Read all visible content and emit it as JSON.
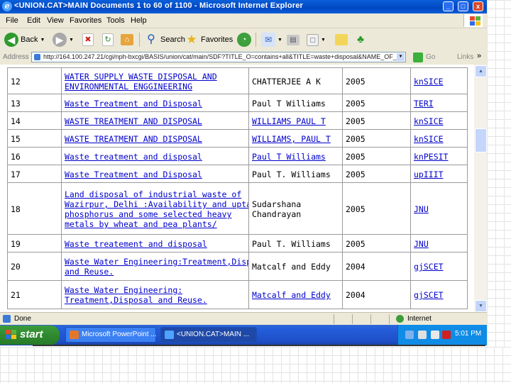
{
  "window": {
    "title": "<UNION.CAT>MAIN Documents 1 to 60 of 1100 - Microsoft Internet Explorer",
    "minimize": "_",
    "maximize": "□",
    "close": "x"
  },
  "menu": [
    "File",
    "Edit",
    "View",
    "Favorites",
    "Tools",
    "Help"
  ],
  "toolbar": {
    "back": "Back",
    "search": "Search",
    "favorites": "Favorites"
  },
  "address": {
    "label": "Address",
    "url": "http://164.100.247.21/cgi/nph-bxcgi/BASIS/union/cat/main/SDF?TITLE_O=contains+all&TITLE=waste+disposal&NAME_OF_",
    "go": "Go",
    "links": "Links",
    "more": "»"
  },
  "table": {
    "rows": [
      {
        "num": "12",
        "title_lines": [
          "WATER SUPPLY WASTE DISPOSAL AND",
          "ENVIRONMENTAL ENGGINEERING"
        ],
        "author_lines": [
          "CHATTERJEE A K"
        ],
        "year": "2005",
        "lib": "knSICE",
        "author_link": false
      },
      {
        "num": "13",
        "title_lines": [
          "Waste Treatment and Disposal"
        ],
        "author_lines": [
          "Paul T Williams"
        ],
        "year": "2005",
        "lib": "TERI",
        "author_link": false
      },
      {
        "num": "14",
        "title_lines": [
          "WASTE TREATMENT AND DISPOSAL"
        ],
        "author_lines": [
          "WILLIAMS PAUL T"
        ],
        "year": "2005",
        "lib": "knSICE",
        "author_link": true
      },
      {
        "num": "15",
        "title_lines": [
          "WASTE TREATMENT AND DISPOSAL"
        ],
        "author_lines": [
          "WILLIAMS, PAUL T"
        ],
        "year": "2005",
        "lib": "knSICE",
        "author_link": true
      },
      {
        "num": "16",
        "title_lines": [
          "Waste treatment and disposal"
        ],
        "author_lines": [
          "Paul T Williams"
        ],
        "year": "2005",
        "lib": "knPESIT",
        "author_link": true
      },
      {
        "num": "17",
        "title_lines": [
          "Waste Treatment and Disposal"
        ],
        "author_lines": [
          "Paul T. Williams"
        ],
        "year": "2005",
        "lib": "upIIIT",
        "author_link": false
      },
      {
        "num": "18",
        "title_lines": [
          "Land disposal of industrial waste of",
          "Wazirpur, Delhi :Availability and uptake of",
          "phosphorus and some selected heavy",
          "metals by wheat and pea plants/"
        ],
        "author_lines": [
          "Sudarshana",
          "Chandrayan"
        ],
        "year": "2005",
        "lib": "JNU",
        "author_link": false
      },
      {
        "num": "19",
        "title_lines": [
          "Waste treatement and disposal"
        ],
        "author_lines": [
          "Paul T. Williams"
        ],
        "year": "2005",
        "lib": "JNU",
        "author_link": false
      },
      {
        "num": "20",
        "title_lines": [
          "Waste Water Engineering:Treatment,Disposal",
          "and Reuse."
        ],
        "author_lines": [
          "Matcalf and Eddy"
        ],
        "year": "2004",
        "lib": "gjSCET",
        "author_link": false
      },
      {
        "num": "21",
        "title_lines": [
          "Waste Water Engineering:",
          "Treatment,Disposal and Reuse."
        ],
        "author_lines": [
          "Matcalf and Eddy"
        ],
        "year": "2004",
        "lib": "gjSCET",
        "author_link": true
      }
    ]
  },
  "status": {
    "text": "Done",
    "zone": "Internet"
  },
  "taskbar": {
    "start": "start",
    "items": [
      "Microsoft PowerPoint ...",
      "<UNION.CAT>MAIN ..."
    ],
    "clock": "5:01 PM"
  },
  "colors": {
    "titlebar": "#0a5fd8",
    "link": "#0000cc",
    "start_button": "#2f8a2f",
    "taskbar": "#245edb"
  }
}
